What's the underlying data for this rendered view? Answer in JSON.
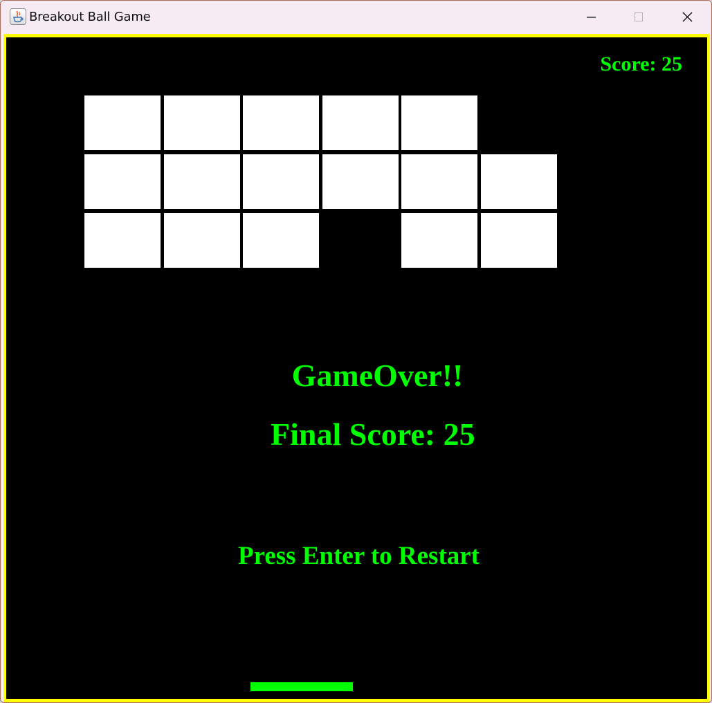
{
  "window": {
    "title": "Breakout Ball Game",
    "icon": "java-cup-icon",
    "controls": [
      "minimize-icon",
      "maximize-icon",
      "close-icon"
    ]
  },
  "game": {
    "score_text": "Score: 25",
    "game_over_text": "GameOver!!",
    "final_score_text": "Final Score: 25",
    "restart_text": "Press Enter to Restart",
    "score": 25,
    "bricks": {
      "rows": 3,
      "cols": 6,
      "present": [
        [
          true,
          true,
          true,
          true,
          true,
          false
        ],
        [
          true,
          true,
          true,
          true,
          true,
          true
        ],
        [
          true,
          true,
          true,
          false,
          true,
          true
        ]
      ]
    },
    "colors": {
      "background": "#000000",
      "border": "#ffff00",
      "brick": "#ffffff",
      "text": "#00ff00",
      "paddle": "#00ff00"
    }
  }
}
